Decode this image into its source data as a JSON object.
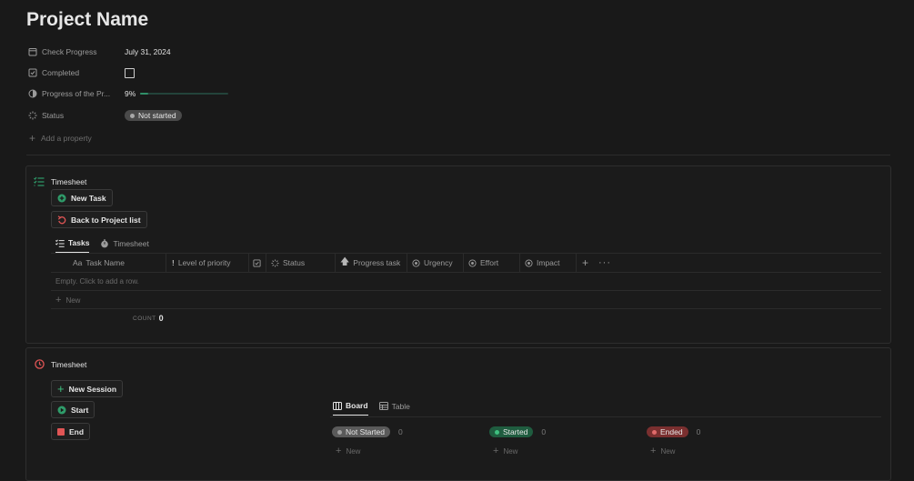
{
  "page": {
    "title": "Project Name"
  },
  "properties": [
    {
      "label": "Check Progress",
      "icon": "calendar-icon",
      "value": "July 31, 2024"
    },
    {
      "label": "Completed",
      "icon": "checkbox-icon",
      "value": ""
    },
    {
      "label": "Progress of the Pr...",
      "icon": "progress-ring-icon",
      "value": "9%",
      "progress": 0.09
    },
    {
      "label": "Status",
      "icon": "status-spinner-icon",
      "value": "Not started"
    }
  ],
  "add_property": "Add a property",
  "tasks_panel": {
    "title": "Timesheet",
    "buttons": {
      "new_task": "New Task",
      "back": "Back to Project list"
    },
    "tabs": [
      "Tasks",
      "Timesheet"
    ],
    "columns": [
      {
        "label": "Task Name",
        "prefix": "Aa"
      },
      {
        "label": "Level of priority"
      },
      {
        "label": ""
      },
      {
        "label": "Status"
      },
      {
        "label": "Progress task"
      },
      {
        "label": "Urgency"
      },
      {
        "label": "Effort"
      },
      {
        "label": "Impact"
      }
    ],
    "empty_text": "Empty. Click to add a row.",
    "new_label": "New",
    "count_label": "COUNT",
    "count_value": "0"
  },
  "session_panel": {
    "title": "Timesheet",
    "buttons": {
      "new_session": "New Session",
      "start": "Start",
      "end": "End"
    },
    "tabs": [
      "Board",
      "Table"
    ],
    "groups": [
      {
        "label": "Not Started",
        "count": "0",
        "color": "#5a5a5a",
        "dot": "#a0a0a0"
      },
      {
        "label": "Started",
        "count": "0",
        "color": "#1f5c3f",
        "dot": "#3fbf7f"
      },
      {
        "label": "Ended",
        "count": "0",
        "color": "#7a2f2f",
        "dot": "#e06a6a"
      }
    ],
    "new_label": "New"
  },
  "colors": {
    "accent_green": "#2f8f68",
    "accent_red": "#e05555",
    "background": "#191919"
  }
}
